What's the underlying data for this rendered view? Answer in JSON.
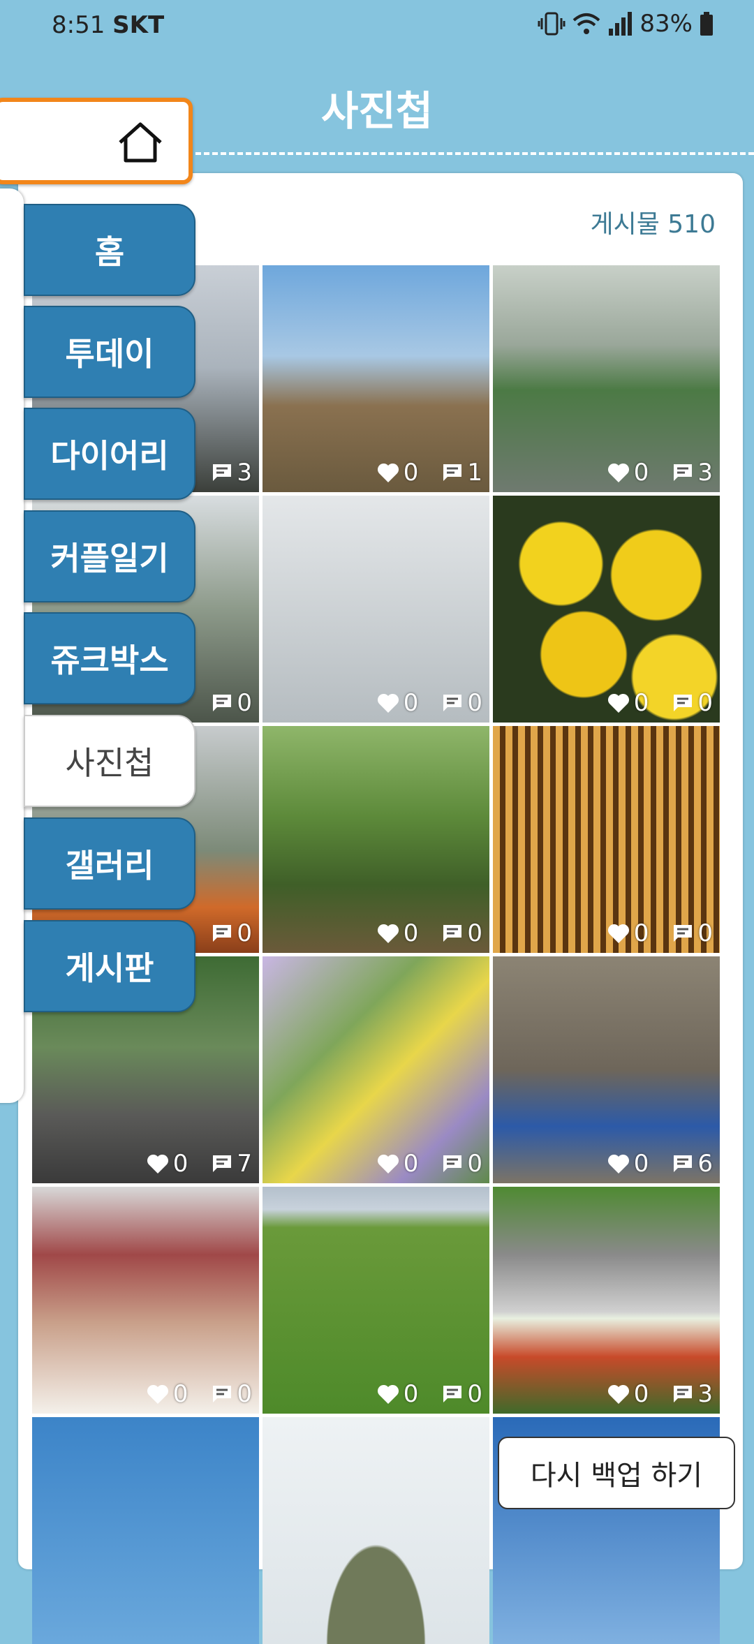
{
  "status_bar": {
    "time": "8:51",
    "carrier": "SKT",
    "battery": "83%"
  },
  "header": {
    "title": "사진첩",
    "home_icon": "home-icon"
  },
  "post_count": "게시물 510",
  "menu": [
    {
      "label": "홈"
    },
    {
      "label": "투데이"
    },
    {
      "label": "다이어리"
    },
    {
      "label": "커플일기"
    },
    {
      "label": "쥬크박스"
    },
    {
      "label": "사진첩",
      "active": true
    },
    {
      "label": "갤러리"
    },
    {
      "label": "게시판"
    }
  ],
  "photos": [
    {
      "likes": "",
      "comments": "3"
    },
    {
      "likes": "0",
      "comments": "1"
    },
    {
      "likes": "0",
      "comments": "3"
    },
    {
      "likes": "",
      "comments": "0"
    },
    {
      "likes": "0",
      "comments": "0"
    },
    {
      "likes": "0",
      "comments": "0"
    },
    {
      "likes": "",
      "comments": "0"
    },
    {
      "likes": "0",
      "comments": "0"
    },
    {
      "likes": "0",
      "comments": "0"
    },
    {
      "likes": "0",
      "comments": "7"
    },
    {
      "likes": "0",
      "comments": "0"
    },
    {
      "likes": "0",
      "comments": "6"
    },
    {
      "likes": "0",
      "comments": "0"
    },
    {
      "likes": "0",
      "comments": "0"
    },
    {
      "likes": "0",
      "comments": "3"
    },
    {
      "likes": "",
      "comments": ""
    },
    {
      "likes": "",
      "comments": ""
    },
    {
      "likes": "",
      "comments": ""
    }
  ],
  "backup_button": "다시 백업 하기",
  "colors": {
    "header_bg": "#86c4de",
    "tab_blue": "#2f7fb2",
    "home_border": "#f2861a",
    "count_text": "#3d7a94"
  }
}
